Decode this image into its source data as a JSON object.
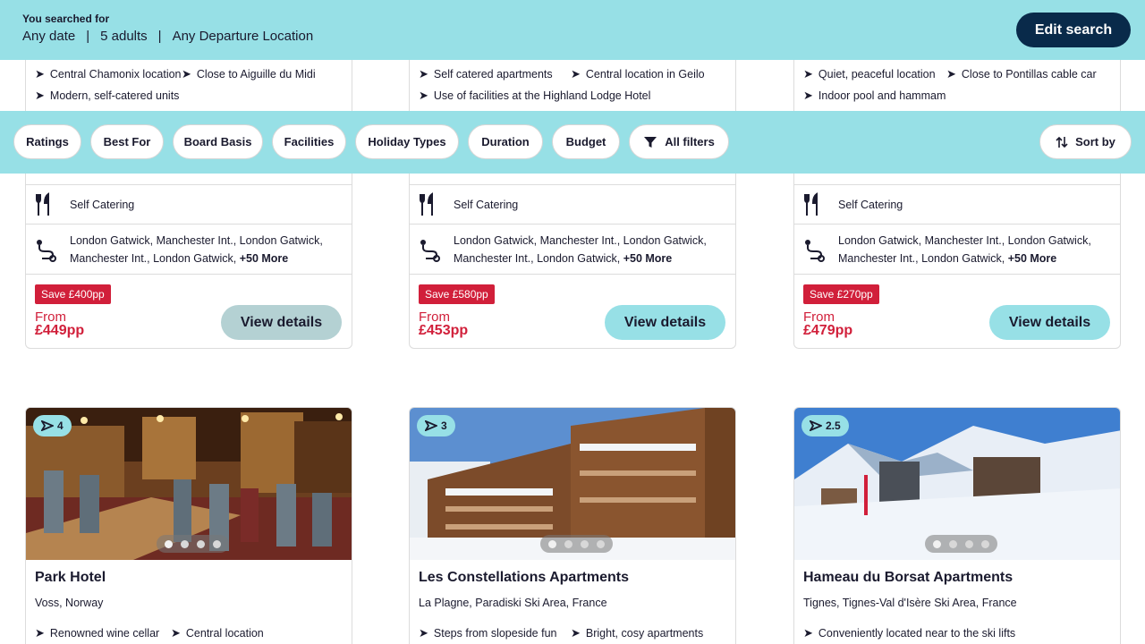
{
  "header": {
    "label": "You searched for",
    "date": "Any date",
    "adults": "5 adults",
    "departure": "Any Departure Location",
    "edit_button": "Edit search"
  },
  "filters": {
    "chips": [
      "Ratings",
      "Best For",
      "Board Basis",
      "Facilities",
      "Holiday Types",
      "Duration",
      "Budget"
    ],
    "all_filters": "All filters",
    "sort_by": "Sort by"
  },
  "top_cards": [
    {
      "features": [
        "Central Chamonix location",
        "Close to Aiguille du Midi",
        "Modern, self-catered units"
      ],
      "board": "Self Catering",
      "airports": "London Gatwick, Manchester Int., London Gatwick,",
      "airports2": "Manchester Int., London Gatwick,",
      "more": "+50 More",
      "save": "Save £400pp",
      "from": "From",
      "price": "£449pp",
      "button": "View details"
    },
    {
      "features": [
        "Self catered apartments",
        "Central location in Geilo",
        "Use of facilities at the Highland Lodge Hotel"
      ],
      "board": "Self Catering",
      "airports": "London Gatwick, Manchester Int., London Gatwick,",
      "airports2": "Manchester Int., London Gatwick,",
      "more": "+50 More",
      "save": "Save £580pp",
      "from": "From",
      "price": "£453pp",
      "button": "View details"
    },
    {
      "features": [
        "Quiet, peaceful location",
        "Close to Pontillas cable car",
        "Indoor pool and hammam"
      ],
      "board": "Self Catering",
      "airports": "London Gatwick, Manchester Int., London Gatwick,",
      "airports2": "Manchester Int., London Gatwick,",
      "more": "+50 More",
      "save": "Save £270pp",
      "from": "From",
      "price": "£479pp",
      "button": "View details"
    }
  ],
  "bottom_cards": [
    {
      "rating": "4",
      "name": "Park Hotel",
      "location": "Voss, Norway",
      "features": [
        "Renowned wine cellar",
        "Central location"
      ]
    },
    {
      "rating": "3",
      "name": "Les Constellations Apartments",
      "location": "La Plagne, Paradiski Ski Area, France",
      "features": [
        "Steps from slopeside fun",
        "Bright, cosy apartments"
      ]
    },
    {
      "rating": "2.5",
      "name": "Hameau du Borsat Apartments",
      "location": "Tignes, Tignes-Val d'Isère Ski Area, France",
      "features": [
        "Conveniently located near to the ski lifts"
      ]
    }
  ],
  "colors": {
    "accent": "#97e0e6",
    "navy": "#092a4a",
    "sale_red": "#d11f3a"
  }
}
